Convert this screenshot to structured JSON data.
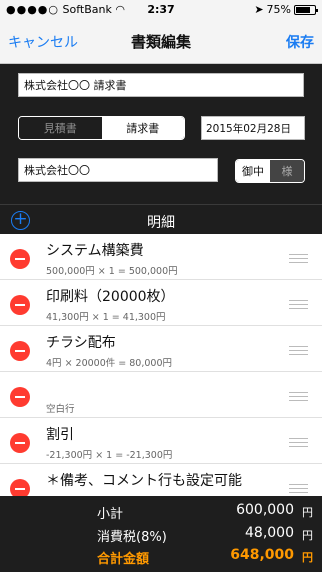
{
  "status": {
    "carrier": "SoftBank",
    "time": "2:37",
    "battery": "75%"
  },
  "nav": {
    "cancel": "キャンセル",
    "title": "書類編集",
    "save": "保存"
  },
  "form": {
    "title_value": "株式会社〇〇 請求書",
    "doc_types": [
      "見積書",
      "請求書"
    ],
    "date": "2015年02月28日",
    "client": "株式会社〇〇",
    "honorifics": [
      "御中",
      "様"
    ]
  },
  "section": {
    "title": "明細"
  },
  "items": [
    {
      "name": "システム構築費",
      "detail": "500,000円 × 1 = 500,000円"
    },
    {
      "name": "印刷料（20000枚）",
      "detail": "41,300円 × 1 = 41,300円"
    },
    {
      "name": "チラシ配布",
      "detail": "4円 × 20000件 = 80,000円"
    },
    {
      "name": "",
      "detail": "空白行"
    },
    {
      "name": "割引",
      "detail": "-21,300円 × 1 = -21,300円"
    },
    {
      "name": "＊備考、コメント行も設定可能",
      "detail": ""
    }
  ],
  "totals": {
    "subtotal_label": "小計",
    "subtotal": "600,000",
    "tax_label": "消費税(8%)",
    "tax": "48,000",
    "total_label": "合計金額",
    "total": "648,000",
    "unit": "円"
  }
}
